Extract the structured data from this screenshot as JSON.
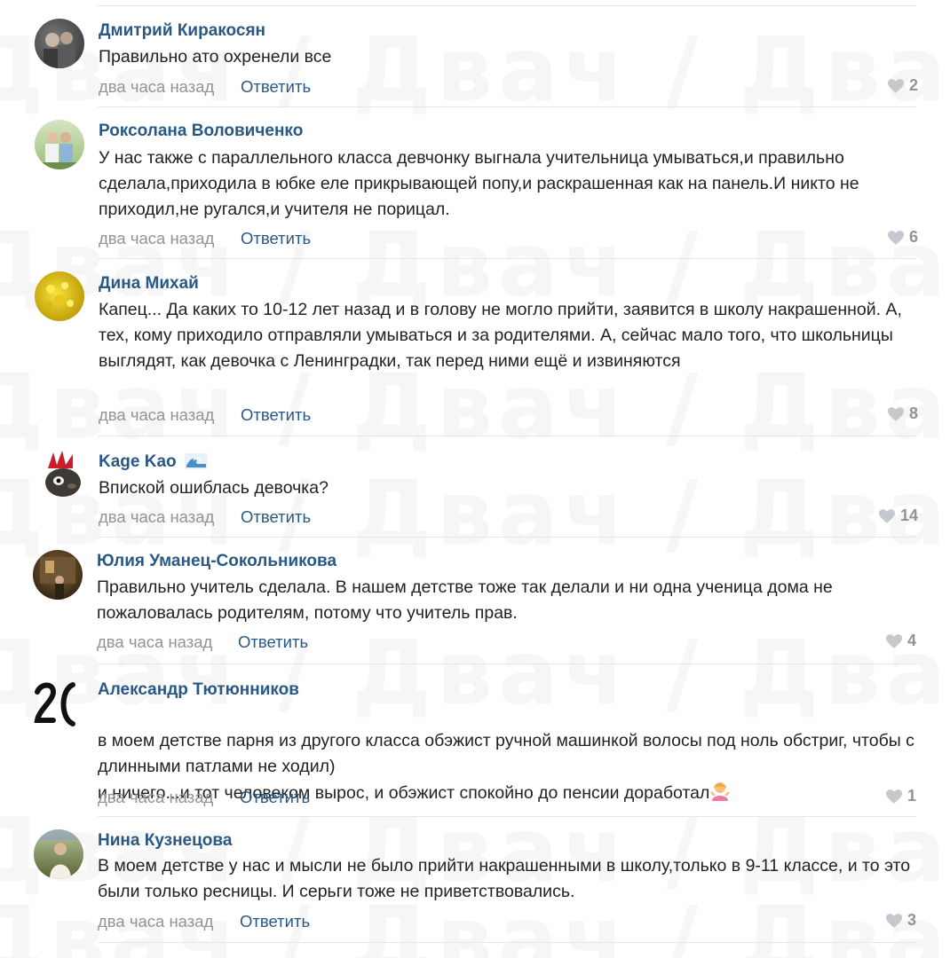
{
  "watermark_text": "Двач",
  "comments": [
    {
      "author": "Дмитрий Киракосян",
      "text": "Правильно ато охренели все",
      "time": "два часа назад",
      "reply": "Ответить",
      "likes": "2"
    },
    {
      "author": "Роксолана Воловиченко",
      "text": "У нас также с параллельного класса девчонку выгнала учительница умываться,и правильно сделала,приходила в юбке еле прикрывающей попу,и раскрашенная как на панель.И никто не приходил,не ругался,и учителя не порицал.",
      "time": "два часа назад",
      "reply": "Ответить",
      "likes": "6"
    },
    {
      "author": "Дина Михай",
      "text": "Капец... Да каких то 10-12 лет назад и в голову не могло прийти, заявится в школу накрашенной. А, тех, кому приходило отправляли умываться и за родителями. А, сейчас мало того, что школьницы выглядят, как девочка с Ленинградки, так перед ними ещё и извиняются",
      "time": "два часа назад",
      "reply": "Ответить",
      "likes": "8"
    },
    {
      "author": "Kage Kao",
      "text": "Впиской ошиблась девочка?",
      "time": "два часа назад",
      "reply": "Ответить",
      "likes": "14"
    },
    {
      "author": "Юлия Уманец-Сокольникова",
      "text": "Правильно учитель сделала. В нашем детстве тоже так делали и ни одна ученица дома не пожаловалась родителям, потому что учитель прав.",
      "time": "два часа назад",
      "reply": "Ответить",
      "likes": "4"
    },
    {
      "author": "Александр Тютюнников",
      "text": "в моем детстве парня из другого класса обэжист ручной машинкой волосы под ноль обстриг, чтобы с длинными патлами не ходил)\nи ничего...и тот человеком вырос, и обэжист спокойно до пенсии доработал",
      "time": "два часа назад",
      "reply": "Ответить",
      "likes": "1"
    },
    {
      "author": "Нина Кузнецова",
      "text": "В моем детстве у нас и мысли не было прийти накрашенными в школу,только в 9-11 классе, и то это были только ресницы. И серьги тоже не приветствовались.",
      "time": "два часа назад",
      "reply": "Ответить",
      "likes": "3"
    }
  ],
  "colors": {
    "link": "#2a5885",
    "muted": "#939393",
    "text": "#222222",
    "divider": "#e4e6ea"
  }
}
